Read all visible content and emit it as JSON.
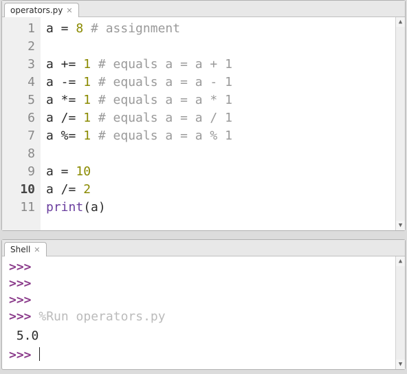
{
  "editor": {
    "tab_label": "operators.py",
    "current_line": 10,
    "lines": [
      {
        "n": 1,
        "tokens": [
          [
            "a = ",
            ""
          ],
          [
            "8",
            "num"
          ],
          [
            " # assignment",
            "com"
          ]
        ]
      },
      {
        "n": 2,
        "tokens": [
          [
            "",
            ""
          ]
        ]
      },
      {
        "n": 3,
        "tokens": [
          [
            "a += ",
            ""
          ],
          [
            "1",
            "num"
          ],
          [
            " # equals a = a + 1",
            "com"
          ]
        ]
      },
      {
        "n": 4,
        "tokens": [
          [
            "a -= ",
            ""
          ],
          [
            "1",
            "num"
          ],
          [
            " # equals a = a - 1",
            "com"
          ]
        ]
      },
      {
        "n": 5,
        "tokens": [
          [
            "a *= ",
            ""
          ],
          [
            "1",
            "num"
          ],
          [
            " # equals a = a * 1",
            "com"
          ]
        ]
      },
      {
        "n": 6,
        "tokens": [
          [
            "a /= ",
            ""
          ],
          [
            "1",
            "num"
          ],
          [
            " # equals a = a / 1",
            "com"
          ]
        ]
      },
      {
        "n": 7,
        "tokens": [
          [
            "a %= ",
            ""
          ],
          [
            "1",
            "num"
          ],
          [
            " # equals a = a % 1",
            "com"
          ]
        ]
      },
      {
        "n": 8,
        "tokens": [
          [
            "",
            ""
          ]
        ]
      },
      {
        "n": 9,
        "tokens": [
          [
            "a = ",
            ""
          ],
          [
            "10",
            "num"
          ]
        ]
      },
      {
        "n": 10,
        "tokens": [
          [
            "a /= ",
            ""
          ],
          [
            "2",
            "num"
          ]
        ]
      },
      {
        "n": 11,
        "tokens": [
          [
            "print",
            "fn"
          ],
          [
            "(a)",
            ""
          ]
        ]
      }
    ]
  },
  "shell": {
    "tab_label": "Shell",
    "prompt": ">>> ",
    "arrow": ">>>",
    "run_command": "%Run operators.py",
    "output": "5.0",
    "lines": [
      {
        "kind": "arrow"
      },
      {
        "kind": "prompt_only"
      },
      {
        "kind": "prompt_only"
      },
      {
        "kind": "run"
      },
      {
        "kind": "output"
      },
      {
        "kind": "prompt_cursor"
      }
    ]
  }
}
